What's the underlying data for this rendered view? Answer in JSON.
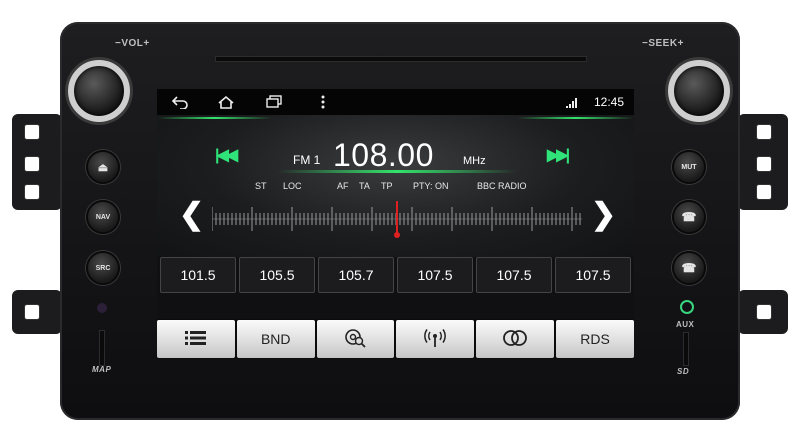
{
  "panel": {
    "vol_label": "VOL",
    "seek_label": "SEEK",
    "left_buttons": [
      "⏏",
      "NAV",
      "SRC"
    ],
    "right_buttons": [
      "MUT",
      "☎",
      "☎"
    ],
    "aux_label": "AUX",
    "map_label": "MAP",
    "sd_label": "SD"
  },
  "status_bar": {
    "time": "12:45"
  },
  "radio": {
    "band": "FM 1",
    "frequency": "108.00",
    "unit": "MHz",
    "flags": [
      "ST",
      "LOC",
      "AF",
      "TA",
      "TP",
      "PTY: ON",
      "BBC RADIO"
    ]
  },
  "presets": [
    "101.5",
    "105.5",
    "105.7",
    "107.5",
    "107.5",
    "107.5"
  ],
  "bottom_bar": {
    "menu_icon": "list-icon",
    "band_label": "BND",
    "scan_icon": "search-disc-icon",
    "signal_icon": "antenna-icon",
    "stereo_icon": "stereo-icon",
    "rds_label": "RDS"
  },
  "colors": {
    "accent_green": "#2fe37a",
    "tuner_needle": "#e02020"
  }
}
